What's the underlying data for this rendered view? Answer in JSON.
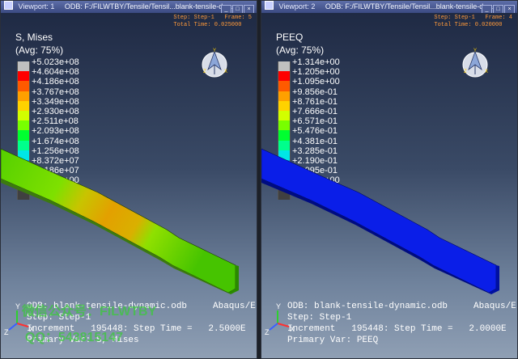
{
  "viewports": [
    {
      "title": "Viewport: 1",
      "odb_path": "ODB: F:/FILWTBY/Tensile/Tensil...blank-tensile-dyn...",
      "step_line": "Step: Step-1   Frame: 5",
      "time_line": "Total Time: 0.025000",
      "legend_title": "S, Mises",
      "legend_avg": "(Avg: 75%)",
      "legend_values": [
        "+5.023e+08",
        "+4.604e+08",
        "+4.186e+08",
        "+3.767e+08",
        "+3.349e+08",
        "+2.930e+08",
        "+2.511e+08",
        "+2.093e+08",
        "+1.674e+08",
        "+1.256e+08",
        "+8.372e+07",
        "+4.186e+07",
        "+0.000e+00"
      ],
      "footer_odb": "ODB: blank-tensile-dynamic.odb",
      "footer_right": "Abaqus/E",
      "footer_step": "Step: Step-1",
      "footer_increment": "Increment   195448: Step Time =   2.5000E",
      "footer_primary": "Primary Var: S, Mises",
      "watermark_line1": "微信公众号：FILWTBY",
      "watermark_line2": "QQ：543815147"
    },
    {
      "title": "Viewport: 2",
      "odb_path": "ODB: F:/FILWTBY/Tensile/Tensil...blank-tensile-dyn...",
      "step_line": "Step: Step-1   Frame: 4",
      "time_line": "Total Time: 0.020000",
      "legend_title": "PEEQ",
      "legend_avg": "(Avg: 75%)",
      "legend_values": [
        "+1.314e+00",
        "+1.205e+00",
        "+1.095e+00",
        "+9.856e-01",
        "+8.761e-01",
        "+7.666e-01",
        "+6.571e-01",
        "+5.476e-01",
        "+4.381e-01",
        "+3.285e-01",
        "+2.190e-01",
        "+1.095e-01",
        "+0.000e+00"
      ],
      "footer_odb": "ODB: blank-tensile-dynamic.odb",
      "footer_right": "Abaqus/E",
      "footer_step": "Step: Step-1",
      "footer_increment": "Increment   195448: Step Time =   2.0000E",
      "footer_primary": "Primary Var: PEEQ"
    }
  ],
  "legend_colors": [
    "#c0c0c0",
    "#ff0000",
    "#ff5a00",
    "#ffa000",
    "#ffd200",
    "#d2ff00",
    "#78ff00",
    "#00ff30",
    "#00ff8c",
    "#00e6e6",
    "#0096ff",
    "#0046ff",
    "#0000ff",
    "#404040"
  ],
  "axis_labels": {
    "x": "X",
    "y": "Y",
    "z": "Z"
  }
}
